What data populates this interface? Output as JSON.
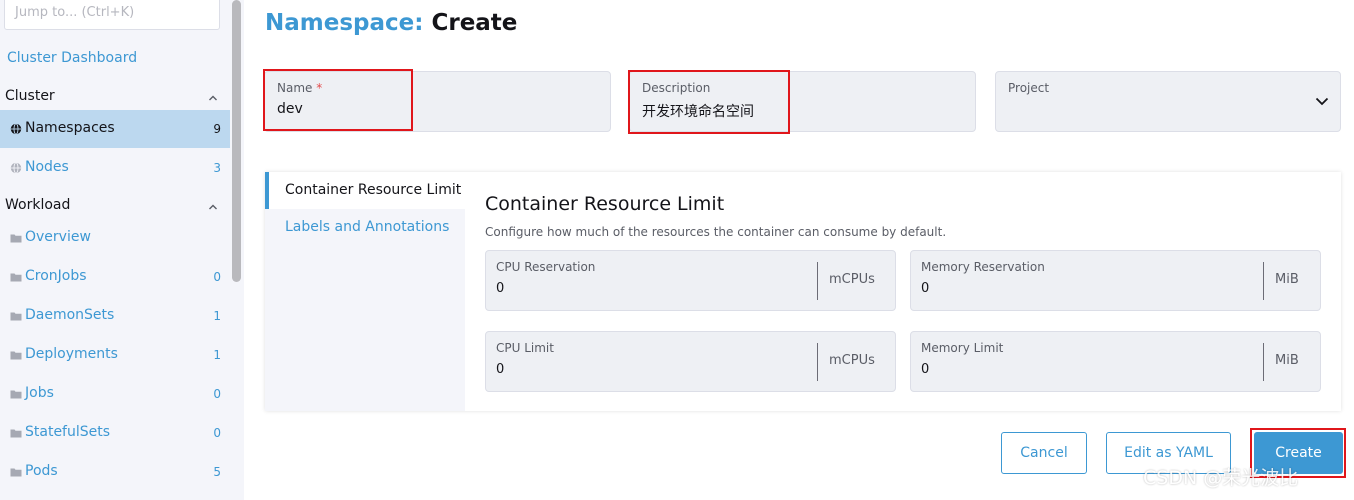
{
  "search": {
    "placeholder": "Jump to... (Ctrl+K)"
  },
  "sidebar": {
    "dashboard_link": "Cluster Dashboard",
    "cluster_group": "Cluster",
    "cluster_items": [
      {
        "label": "Namespaces",
        "count": "9",
        "icon": "globe-icon",
        "active": true
      },
      {
        "label": "Nodes",
        "count": "3",
        "icon": "globe-icon",
        "active": false
      }
    ],
    "workload_group": "Workload",
    "workload_items": [
      {
        "label": "Overview",
        "count": "",
        "icon": "folder-icon"
      },
      {
        "label": "CronJobs",
        "count": "0",
        "icon": "folder-icon"
      },
      {
        "label": "DaemonSets",
        "count": "1",
        "icon": "folder-icon"
      },
      {
        "label": "Deployments",
        "count": "1",
        "icon": "folder-icon"
      },
      {
        "label": "Jobs",
        "count": "0",
        "icon": "folder-icon"
      },
      {
        "label": "StatefulSets",
        "count": "0",
        "icon": "folder-icon"
      },
      {
        "label": "Pods",
        "count": "5",
        "icon": "folder-icon"
      }
    ]
  },
  "header": {
    "resource": "Namespace:",
    "action": "Create"
  },
  "form": {
    "name": {
      "label": "Name",
      "required_mark": "*",
      "value": "dev"
    },
    "description": {
      "label": "Description",
      "value": "开发环境命名空间"
    },
    "project": {
      "label": "Project",
      "value": ""
    }
  },
  "tabs": [
    {
      "label": "Container Resource Limit",
      "active": true
    },
    {
      "label": "Labels and Annotations",
      "active": false
    }
  ],
  "section": {
    "title": "Container Resource Limit",
    "description": "Configure how much of the resources the container can consume by default.",
    "fields": {
      "cpu_reservation": {
        "label": "CPU Reservation",
        "value": "0",
        "unit": "mCPUs"
      },
      "memory_reservation": {
        "label": "Memory Reservation",
        "value": "0",
        "unit": "MiB"
      },
      "cpu_limit": {
        "label": "CPU Limit",
        "value": "0",
        "unit": "mCPUs"
      },
      "memory_limit": {
        "label": "Memory Limit",
        "value": "0",
        "unit": "MiB"
      }
    }
  },
  "buttons": {
    "cancel": "Cancel",
    "edit_yaml": "Edit as YAML",
    "create": "Create"
  },
  "watermark": "CSDN @荣光波比",
  "colors": {
    "accent": "#3d98d3",
    "highlight": "#e0161b",
    "active_nav_bg": "#bcd8ef",
    "required": "#e34b4b"
  }
}
